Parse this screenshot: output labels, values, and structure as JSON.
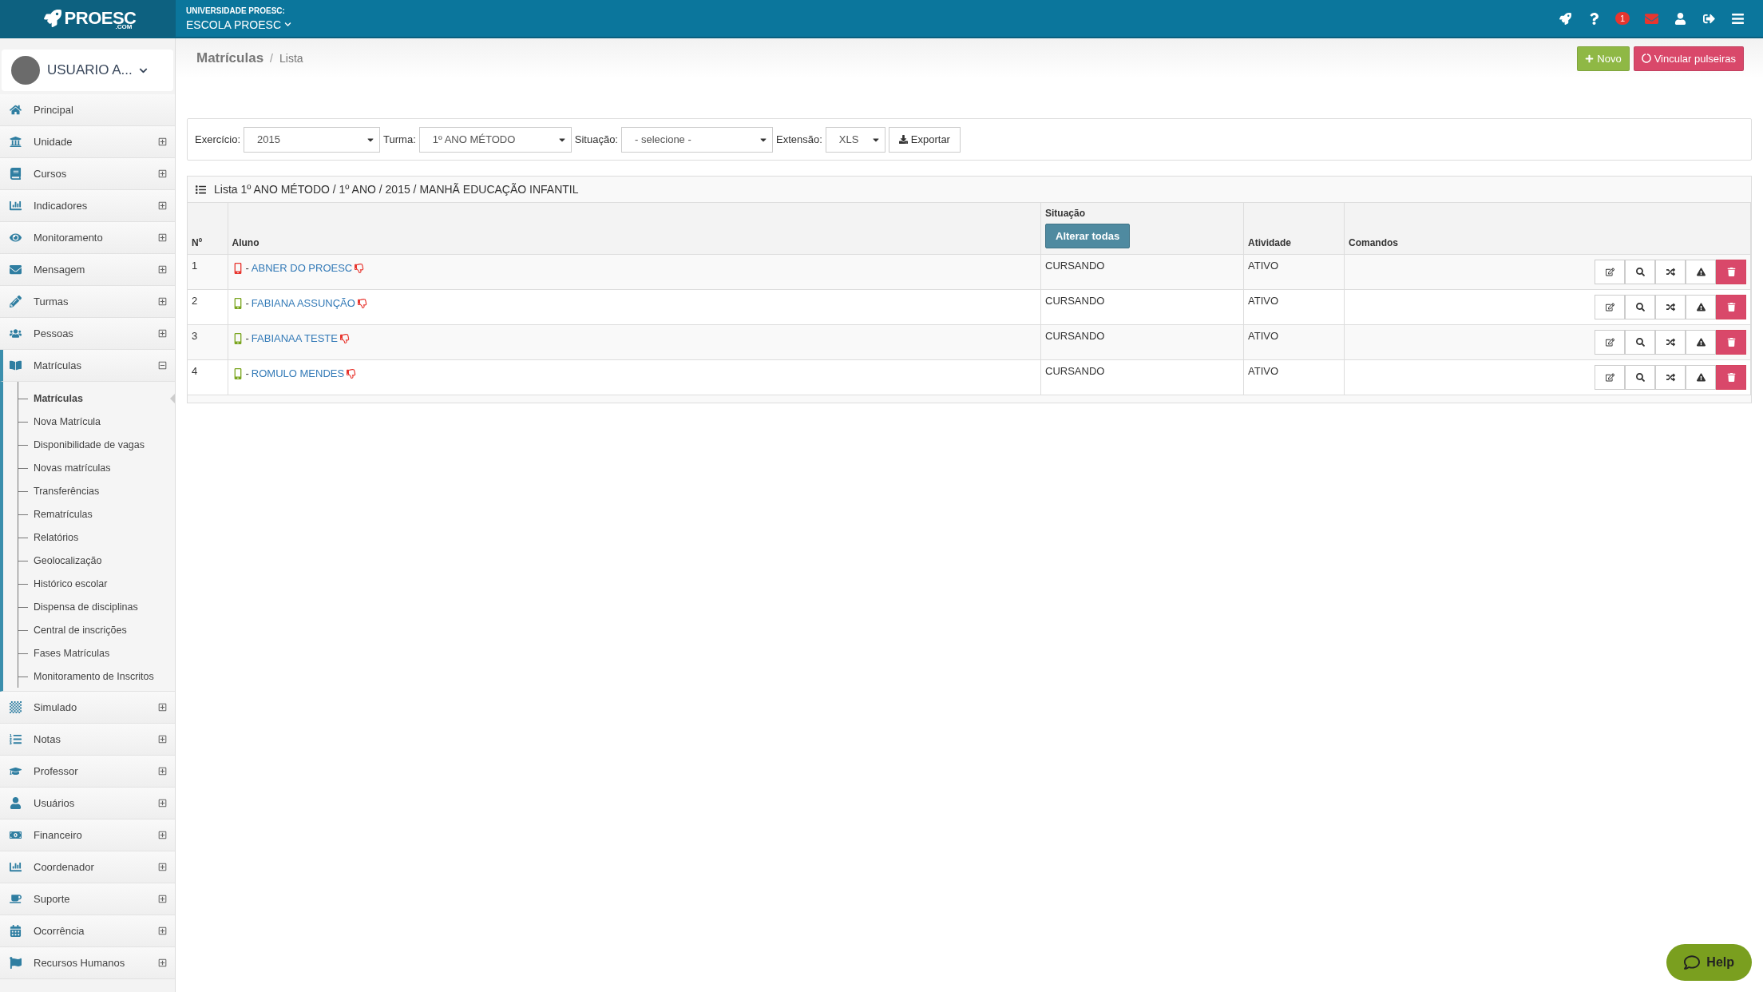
{
  "header": {
    "logo": "PROESC",
    "logo_suffix": ".COM",
    "institution_label": "UNIVERSIDADE PROESC:",
    "school": "ESCOLA PROESC",
    "notification_count": "1"
  },
  "user": {
    "name": "USUARIO A..."
  },
  "sidebar": {
    "items": [
      {
        "label": "Principal",
        "kind": "link"
      },
      {
        "label": "Unidade",
        "kind": "group",
        "expanded": false
      },
      {
        "label": "Cursos",
        "kind": "group",
        "expanded": false
      },
      {
        "label": "Indicadores",
        "kind": "group",
        "expanded": false
      },
      {
        "label": "Monitoramento",
        "kind": "group",
        "expanded": false
      },
      {
        "label": "Mensagem",
        "kind": "group",
        "expanded": false
      },
      {
        "label": "Turmas",
        "kind": "group",
        "expanded": false
      },
      {
        "label": "Pessoas",
        "kind": "group",
        "expanded": false
      },
      {
        "label": "Matrículas",
        "kind": "group",
        "expanded": true,
        "children": [
          {
            "label": "Matrículas",
            "selected": true
          },
          {
            "label": "Nova Matrícula",
            "selected": false
          },
          {
            "label": "Disponibilidade de vagas",
            "selected": false
          },
          {
            "label": "Novas matrículas",
            "selected": false
          },
          {
            "label": "Transferências",
            "selected": false
          },
          {
            "label": "Rematrículas",
            "selected": false
          },
          {
            "label": "Relatórios",
            "selected": false
          },
          {
            "label": "Geolocalização",
            "selected": false
          },
          {
            "label": "Histórico escolar",
            "selected": false
          },
          {
            "label": "Dispensa de disciplinas",
            "selected": false
          },
          {
            "label": "Central de inscrições",
            "selected": false
          },
          {
            "label": "Fases Matrículas",
            "selected": false
          },
          {
            "label": "Monitoramento de Inscritos",
            "selected": false
          }
        ]
      },
      {
        "label": "Simulado",
        "kind": "group",
        "expanded": false
      },
      {
        "label": "Notas",
        "kind": "group",
        "expanded": false
      },
      {
        "label": "Professor",
        "kind": "group",
        "expanded": false
      },
      {
        "label": "Usuários",
        "kind": "group",
        "expanded": false
      },
      {
        "label": "Financeiro",
        "kind": "group",
        "expanded": false
      },
      {
        "label": "Coordenador",
        "kind": "group",
        "expanded": false
      },
      {
        "label": "Suporte",
        "kind": "group",
        "expanded": false
      },
      {
        "label": "Ocorrência",
        "kind": "group",
        "expanded": false
      },
      {
        "label": "Recursos Humanos",
        "kind": "group",
        "expanded": false
      }
    ]
  },
  "breadcrumb": [
    "Matrículas",
    "Lista"
  ],
  "breadcrumb_separator": "/",
  "actions": [
    {
      "label": "Novo",
      "kind": "new"
    },
    {
      "label": "Vincular pulseiras",
      "kind": "link"
    }
  ],
  "filters": [
    {
      "label": "Exercício:",
      "value": "2015",
      "kind": "select"
    },
    {
      "label": "Turma:",
      "value": "1º ANO MÉTODO",
      "kind": "select"
    },
    {
      "label": "Situação:",
      "value": "- selecione -",
      "kind": "select"
    },
    {
      "label": "Extensão:",
      "value": "XLS",
      "kind": "select"
    }
  ],
  "export_button": "Exportar",
  "table": {
    "title": "Lista 1º ANO MÉTODO / 1º ANO / 2015 / MANHÃ EDUCAÇÃO INFANTIL",
    "columns": [
      "Nº",
      "Aluno",
      "Situação",
      "Atividade",
      "Comandos"
    ],
    "change_all_button": "Alterar todas",
    "rows": [
      {
        "number": "1",
        "dash": "-",
        "name": "ABNER DO PROESC",
        "color": "#e8352e",
        "situation": "CURSANDO",
        "activity": "ATIVO"
      },
      {
        "number": "2",
        "dash": "-",
        "name": "FABIANA ASSUNÇÃO",
        "color": "#7aa51f",
        "situation": "CURSANDO",
        "activity": "ATIVO"
      },
      {
        "number": "3",
        "dash": "-",
        "name": "FABIANAA TESTE",
        "color": "#7aa51f",
        "situation": "CURSANDO",
        "activity": "ATIVO"
      },
      {
        "number": "4",
        "dash": "-",
        "name": "ROMULO MENDES",
        "color": "#7aa51f",
        "situation": "CURSANDO",
        "activity": "ATIVO"
      }
    ]
  },
  "help_button": "Help"
}
